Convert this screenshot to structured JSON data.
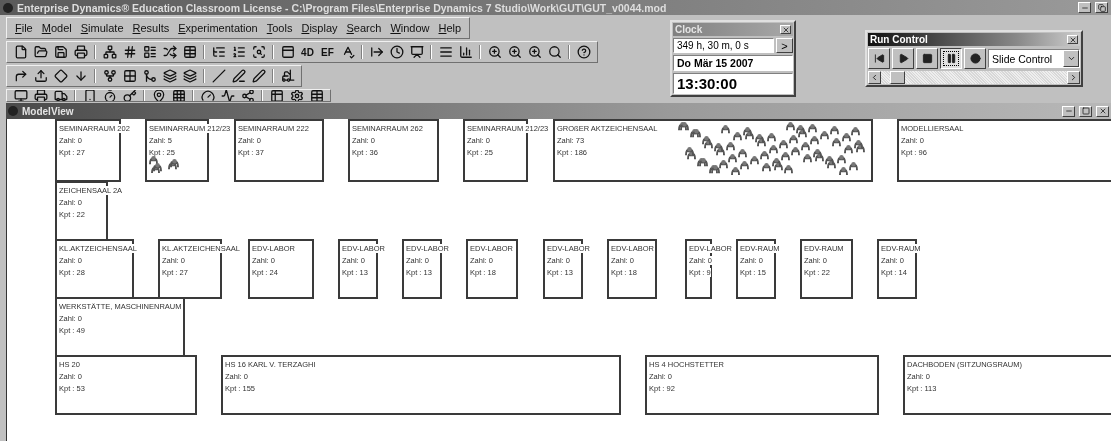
{
  "window": {
    "title": "Enterprise Dynamics® Education Classroom License -  C:\\Program Files\\Enterprise Dynamics 7 Studio\\Work\\GUT\\GUT_v0044.mod"
  },
  "menu": [
    "File",
    "Model",
    "Simulate",
    "Results",
    "Experimentation",
    "Tools",
    "Display",
    "Search",
    "Window",
    "Help"
  ],
  "toolbar_texts": [
    "4D",
    "EF"
  ],
  "clock": {
    "title": "Clock",
    "elapsed": "349 h, 30 m, 0 s",
    "advance": ">",
    "date": "Do Mär 15 2007",
    "time": "13:30:00"
  },
  "run_control": {
    "title": "Run Control",
    "mode": "Slide Control",
    "speed": {
      "level": 0.05
    },
    "buttons": [
      {
        "kind": "reset",
        "selected": false
      },
      {
        "kind": "play",
        "selected": false
      },
      {
        "kind": "stop",
        "selected": false
      },
      {
        "kind": "pause",
        "selected": true
      },
      {
        "kind": "record",
        "selected": false
      }
    ]
  },
  "model_view": {
    "title": "ModelView",
    "rooms": [
      {
        "name": "SEMINARRAUM 202",
        "count": "Zahl: 0",
        "capacity": "Kpt : 27",
        "occupied": false
      },
      {
        "name": "SEMINARRAUM 212/23",
        "count": "Zahl: 5",
        "capacity": "Kpt : 25",
        "occupied": true
      },
      {
        "name": "SEMINARRAUM 222",
        "count": "Zahl: 0",
        "capacity": "Kpt : 37",
        "occupied": false
      },
      {
        "name": "SEMINARRAUM 262",
        "count": "Zahl: 0",
        "capacity": "Kpt : 36",
        "occupied": false
      },
      {
        "name": "SEMINARRAUM 212/23",
        "count": "Zahl: 0",
        "capacity": "Kpt : 25",
        "occupied": false
      },
      {
        "name": "GROßER AKTZEICHENSAAL",
        "count": "Zahl: 73",
        "capacity": "Kpt : 186",
        "occupied": true
      },
      {
        "name": "MODELLIERSAAL",
        "count": "Zahl: 0",
        "capacity": "Kpt : 96",
        "occupied": false
      },
      {
        "name": "ZEICHENSAAL 2A",
        "count": "Zahl: 0",
        "capacity": "Kpt : 22",
        "occupied": false
      },
      {
        "name": "KL.AKTZEICHENSAAL",
        "count": "Zahl: 0",
        "capacity": "Kpt : 28",
        "occupied": false
      },
      {
        "name": "KL.AKTZEICHENSAAL",
        "count": "Zahl: 0",
        "capacity": "Kpt : 27",
        "occupied": false
      },
      {
        "name": "EDV-LABOR",
        "count": "Zahl: 0",
        "capacity": "Kpt : 24",
        "occupied": false
      },
      {
        "name": "EDV-LABOR",
        "count": "Zahl: 0",
        "capacity": "Kpt : 13",
        "occupied": false
      },
      {
        "name": "EDV-LABOR",
        "count": "Zahl: 0",
        "capacity": "Kpt : 13",
        "occupied": false
      },
      {
        "name": "EDV-LABOR",
        "count": "Zahl: 0",
        "capacity": "Kpt : 18",
        "occupied": false
      },
      {
        "name": "EDV-LABOR",
        "count": "Zahl: 0",
        "capacity": "Kpt : 13",
        "occupied": false
      },
      {
        "name": "EDV-LABOR",
        "count": "Zahl: 0",
        "capacity": "Kpt : 18",
        "occupied": false
      },
      {
        "name": "EDV-LABOR",
        "count": "Zahl: 0",
        "capacity": "Kpt : 9",
        "occupied": false
      },
      {
        "name": "EDV-RAUM",
        "count": "Zahl: 0",
        "capacity": "Kpt : 15",
        "occupied": false
      },
      {
        "name": "EDV-RAUM",
        "count": "Zahl: 0",
        "capacity": "Kpt : 22",
        "occupied": false
      },
      {
        "name": "EDV-RAUM",
        "count": "Zahl: 0",
        "capacity": "Kpt : 14",
        "occupied": false
      },
      {
        "name": "WERKSTÄTTE, MASCHINENRAUM",
        "count": "Zahl: 0",
        "capacity": "Kpt : 49",
        "occupied": false
      },
      {
        "name": "HS 20",
        "count": "Zahl: 0",
        "capacity": "Kpt : 53",
        "occupied": false
      },
      {
        "name": "HS 16 KARL V. TERZAGHI",
        "count": "Zahl: 0",
        "capacity": "Kpt : 155",
        "occupied": false
      },
      {
        "name": "HS 4 HOCHSTETTER",
        "count": "Zahl: 0",
        "capacity": "Kpt : 92",
        "occupied": false
      },
      {
        "name": "DACHBODEN (SITZUNGSRAUM)",
        "count": "Zahl: 0",
        "capacity": "Kpt : 113",
        "occupied": false
      }
    ]
  }
}
